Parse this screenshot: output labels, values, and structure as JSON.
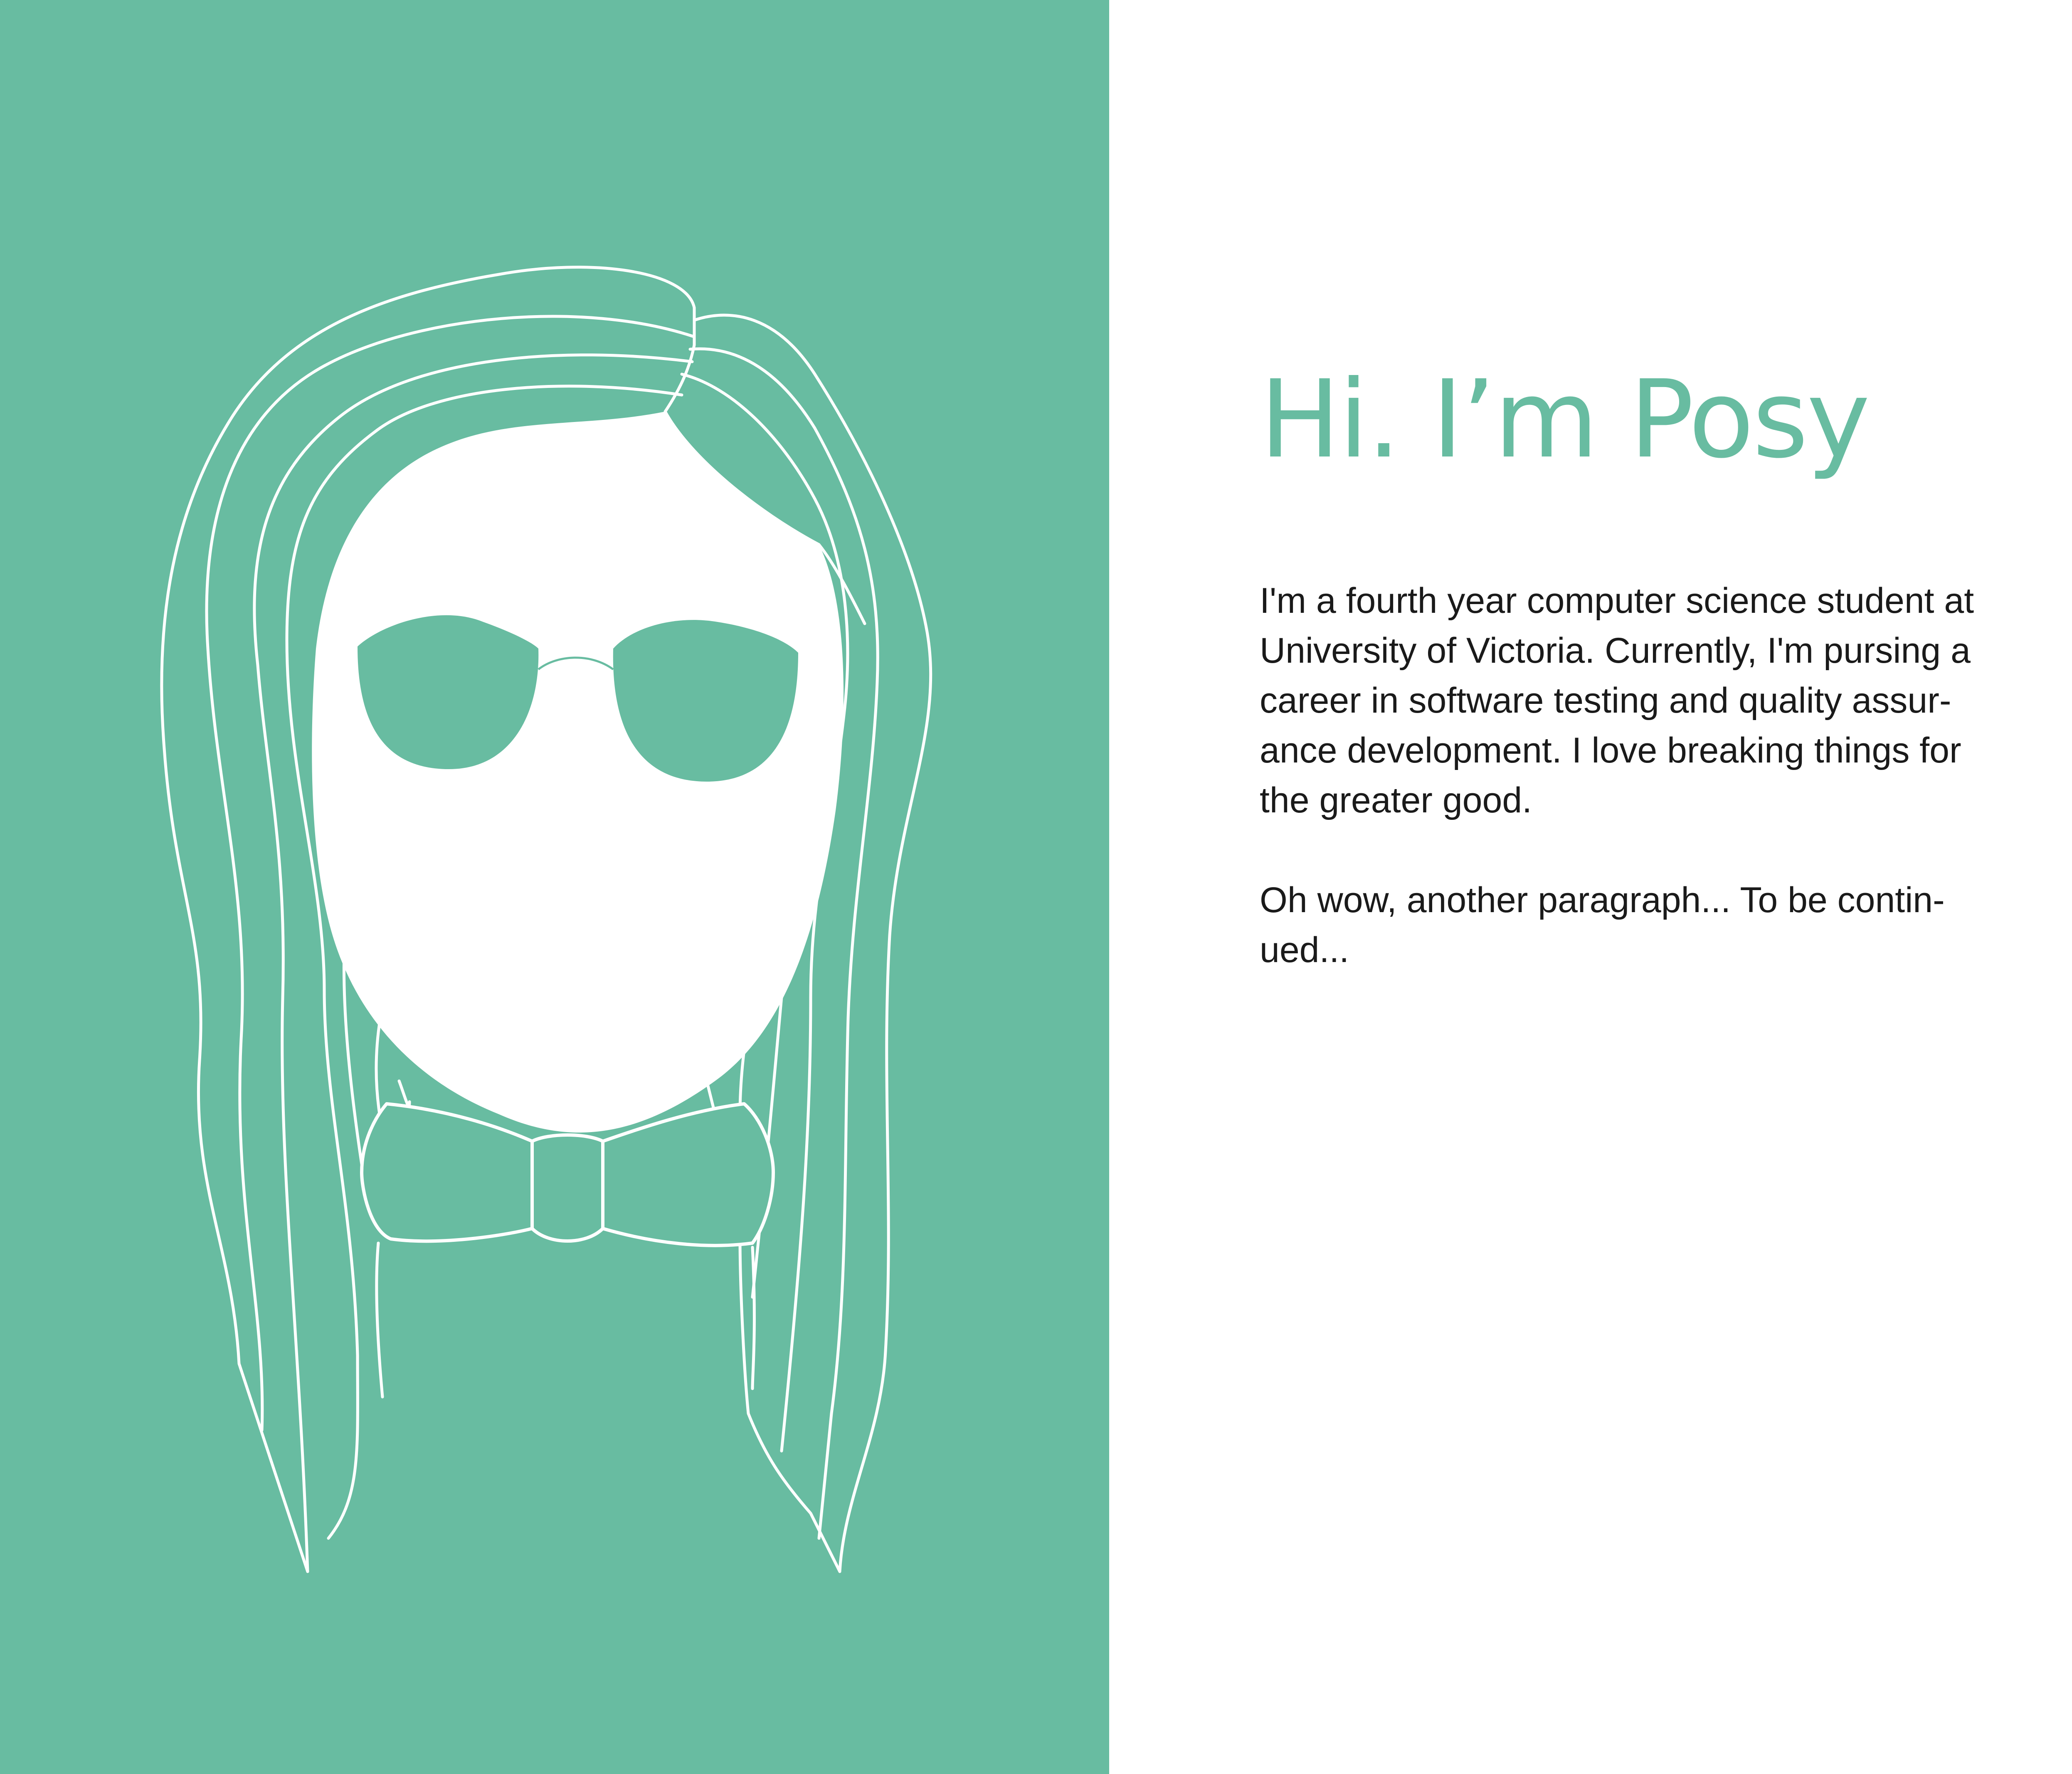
{
  "colors": {
    "accent": "#68bca1",
    "panel_background": "#68bca1",
    "line_art": "#ffffff",
    "body_text": "#1a1a1a",
    "page_background": "#ffffff"
  },
  "illustration": {
    "subject": "portrait-avatar",
    "icons": [
      "avatar-icon",
      "sunglasses-icon",
      "bow-tie-icon"
    ]
  },
  "intro": {
    "headline": "Hi. I’m Posy",
    "paragraphs": [
      "I'm a fourth year computer science student at\nUniversity of Victoria. Currently, I'm pursing a\ncareer in software testing and quality assur-\nance development. I love breaking things for\nthe greater good.",
      "Oh wow, another paragraph... To be contin-\nued..."
    ]
  }
}
